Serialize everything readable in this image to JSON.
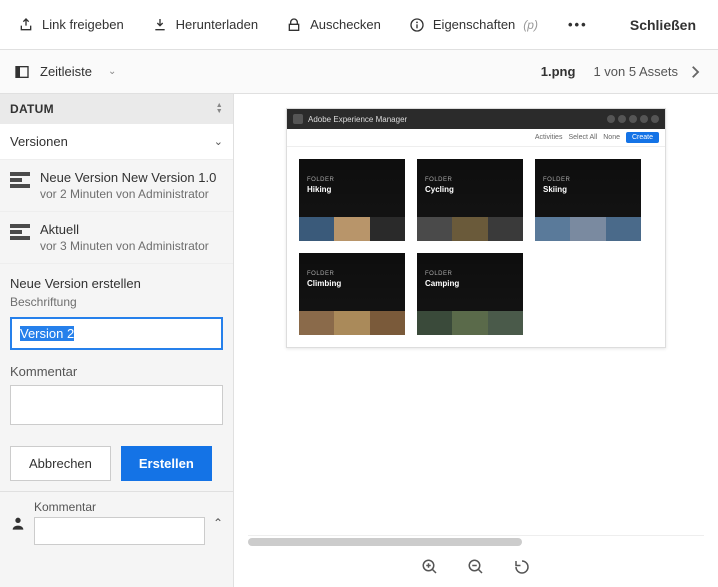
{
  "topbar": {
    "share": "Link freigeben",
    "download": "Herunterladen",
    "checkout": "Auschecken",
    "properties": "Eigenschaften",
    "properties_shortcut": "(p)",
    "close": "Schließen"
  },
  "secondbar": {
    "rail_label": "Zeitleiste",
    "asset_name": "1.png",
    "asset_count": "1 von 5 Assets"
  },
  "sidebar": {
    "datum": "DATUM",
    "versionen": "Versionen",
    "entries": [
      {
        "title": "Neue Version New Version 1.0",
        "sub": "vor 2 Minuten von Administrator"
      },
      {
        "title": "Aktuell",
        "sub": "vor 3 Minuten von Administrator"
      }
    ],
    "form": {
      "header": "Neue Version erstellen",
      "label_field": "Beschriftung",
      "label_value": "Version 2",
      "comment_field": "Kommentar",
      "cancel": "Abbrechen",
      "create": "Erstellen"
    },
    "commentbox": {
      "label": "Kommentar"
    }
  },
  "preview": {
    "app_title": "Adobe Experience Manager",
    "toolbar": {
      "activities": "Activities",
      "select_all": "Select All",
      "none": "None",
      "create": "Create"
    },
    "cards": [
      {
        "type": "FOLDER",
        "name": "Hiking",
        "cls": "c-hiking"
      },
      {
        "type": "FOLDER",
        "name": "Cycling",
        "cls": "c-cycling"
      },
      {
        "type": "FOLDER",
        "name": "Skiing",
        "cls": "c-skiing"
      },
      {
        "type": "FOLDER",
        "name": "Climbing",
        "cls": "c-climbing"
      },
      {
        "type": "FOLDER",
        "name": "Camping",
        "cls": "c-camping"
      }
    ]
  }
}
